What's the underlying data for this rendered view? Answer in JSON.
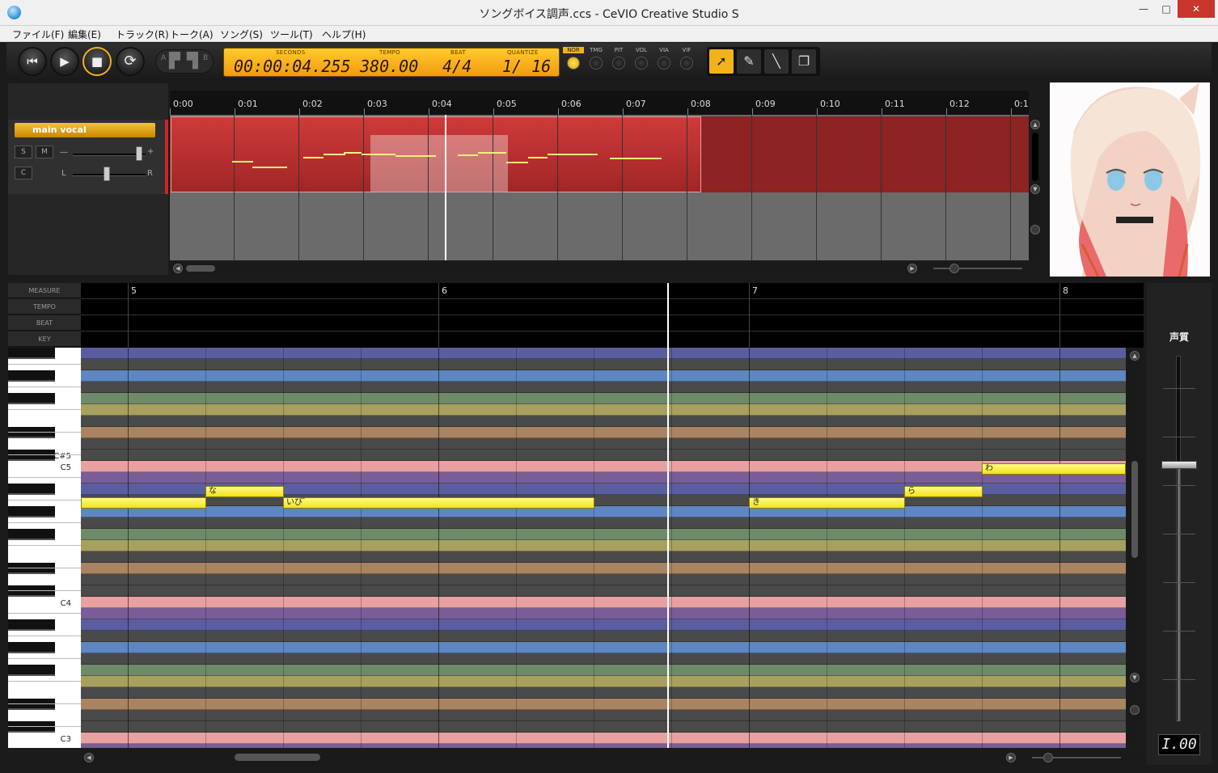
{
  "window": {
    "title": "ソングボイス調声.ccs - CeVIO Creative Studio S",
    "minimize": "—",
    "maximize": "□",
    "close": "✕"
  },
  "menu": [
    "ファイル(F)",
    "編集(E)",
    "トラック(R)",
    "トーク(A)",
    "ソング(S)",
    "ツール(T)",
    "ヘルプ(H)"
  ],
  "transport": {
    "ab_a": "A",
    "ab_b": "B",
    "lcd": {
      "seconds_label": "SECONDS",
      "seconds": "00:00:04.255",
      "tempo_label": "TEMPO",
      "tempo": "380.00",
      "beat_label": "BEAT",
      "beat": "4/4",
      "quantize_label": "QUANTIZE",
      "quantize": "1/ 16"
    },
    "params": [
      "NOR",
      "TMG",
      "PIT",
      "VOL",
      "VIA",
      "VIF"
    ]
  },
  "track": {
    "name": "main vocal",
    "solo": "S",
    "mute": "M",
    "c": "C",
    "vol_minus": "—",
    "vol_plus": "+",
    "pan_l": "L",
    "pan_r": "R"
  },
  "timeline": [
    "0:00",
    "0:01",
    "0:02",
    "0:03",
    "0:04",
    "0:05",
    "0:06",
    "0:07",
    "0:08",
    "0:09",
    "0:10",
    "0:11",
    "0:12",
    "0:1"
  ],
  "roll_headers": {
    "measure": "MEASURE",
    "tempo": "TEMPO",
    "beat": "BEAT",
    "key": "KEY"
  },
  "measures": [
    "5",
    "6",
    "7",
    "8"
  ],
  "keys": {
    "cs5": "C#5",
    "c5": "C5",
    "c4": "C4",
    "c3": "C3"
  },
  "notes": [
    {
      "lyric": ""
    },
    {
      "lyric": "な"
    },
    {
      "lyric": "いびﾞ"
    },
    {
      "lyric": "き"
    },
    {
      "lyric": "ら"
    },
    {
      "lyric": "わ"
    }
  ],
  "param_panel": {
    "title": "声質",
    "value": "1.00",
    "display": "I.00"
  },
  "colors": {
    "accent": "#f2b21b",
    "track": "#c8282b",
    "note": "#f2e316"
  }
}
